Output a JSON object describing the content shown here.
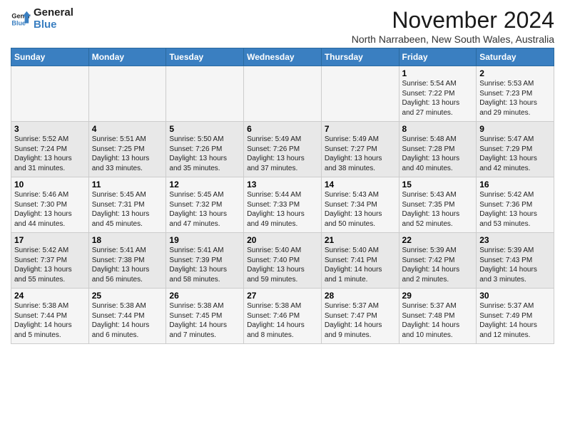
{
  "logo": {
    "line1": "General",
    "line2": "Blue"
  },
  "title": "November 2024",
  "location": "North Narrabeen, New South Wales, Australia",
  "weekdays": [
    "Sunday",
    "Monday",
    "Tuesday",
    "Wednesday",
    "Thursday",
    "Friday",
    "Saturday"
  ],
  "weeks": [
    [
      {
        "day": "",
        "info": ""
      },
      {
        "day": "",
        "info": ""
      },
      {
        "day": "",
        "info": ""
      },
      {
        "day": "",
        "info": ""
      },
      {
        "day": "",
        "info": ""
      },
      {
        "day": "1",
        "info": "Sunrise: 5:54 AM\nSunset: 7:22 PM\nDaylight: 13 hours and 27 minutes."
      },
      {
        "day": "2",
        "info": "Sunrise: 5:53 AM\nSunset: 7:23 PM\nDaylight: 13 hours and 29 minutes."
      }
    ],
    [
      {
        "day": "3",
        "info": "Sunrise: 5:52 AM\nSunset: 7:24 PM\nDaylight: 13 hours and 31 minutes."
      },
      {
        "day": "4",
        "info": "Sunrise: 5:51 AM\nSunset: 7:25 PM\nDaylight: 13 hours and 33 minutes."
      },
      {
        "day": "5",
        "info": "Sunrise: 5:50 AM\nSunset: 7:26 PM\nDaylight: 13 hours and 35 minutes."
      },
      {
        "day": "6",
        "info": "Sunrise: 5:49 AM\nSunset: 7:26 PM\nDaylight: 13 hours and 37 minutes."
      },
      {
        "day": "7",
        "info": "Sunrise: 5:49 AM\nSunset: 7:27 PM\nDaylight: 13 hours and 38 minutes."
      },
      {
        "day": "8",
        "info": "Sunrise: 5:48 AM\nSunset: 7:28 PM\nDaylight: 13 hours and 40 minutes."
      },
      {
        "day": "9",
        "info": "Sunrise: 5:47 AM\nSunset: 7:29 PM\nDaylight: 13 hours and 42 minutes."
      }
    ],
    [
      {
        "day": "10",
        "info": "Sunrise: 5:46 AM\nSunset: 7:30 PM\nDaylight: 13 hours and 44 minutes."
      },
      {
        "day": "11",
        "info": "Sunrise: 5:45 AM\nSunset: 7:31 PM\nDaylight: 13 hours and 45 minutes."
      },
      {
        "day": "12",
        "info": "Sunrise: 5:45 AM\nSunset: 7:32 PM\nDaylight: 13 hours and 47 minutes."
      },
      {
        "day": "13",
        "info": "Sunrise: 5:44 AM\nSunset: 7:33 PM\nDaylight: 13 hours and 49 minutes."
      },
      {
        "day": "14",
        "info": "Sunrise: 5:43 AM\nSunset: 7:34 PM\nDaylight: 13 hours and 50 minutes."
      },
      {
        "day": "15",
        "info": "Sunrise: 5:43 AM\nSunset: 7:35 PM\nDaylight: 13 hours and 52 minutes."
      },
      {
        "day": "16",
        "info": "Sunrise: 5:42 AM\nSunset: 7:36 PM\nDaylight: 13 hours and 53 minutes."
      }
    ],
    [
      {
        "day": "17",
        "info": "Sunrise: 5:42 AM\nSunset: 7:37 PM\nDaylight: 13 hours and 55 minutes."
      },
      {
        "day": "18",
        "info": "Sunrise: 5:41 AM\nSunset: 7:38 PM\nDaylight: 13 hours and 56 minutes."
      },
      {
        "day": "19",
        "info": "Sunrise: 5:41 AM\nSunset: 7:39 PM\nDaylight: 13 hours and 58 minutes."
      },
      {
        "day": "20",
        "info": "Sunrise: 5:40 AM\nSunset: 7:40 PM\nDaylight: 13 hours and 59 minutes."
      },
      {
        "day": "21",
        "info": "Sunrise: 5:40 AM\nSunset: 7:41 PM\nDaylight: 14 hours and 1 minute."
      },
      {
        "day": "22",
        "info": "Sunrise: 5:39 AM\nSunset: 7:42 PM\nDaylight: 14 hours and 2 minutes."
      },
      {
        "day": "23",
        "info": "Sunrise: 5:39 AM\nSunset: 7:43 PM\nDaylight: 14 hours and 3 minutes."
      }
    ],
    [
      {
        "day": "24",
        "info": "Sunrise: 5:38 AM\nSunset: 7:44 PM\nDaylight: 14 hours and 5 minutes."
      },
      {
        "day": "25",
        "info": "Sunrise: 5:38 AM\nSunset: 7:44 PM\nDaylight: 14 hours and 6 minutes."
      },
      {
        "day": "26",
        "info": "Sunrise: 5:38 AM\nSunset: 7:45 PM\nDaylight: 14 hours and 7 minutes."
      },
      {
        "day": "27",
        "info": "Sunrise: 5:38 AM\nSunset: 7:46 PM\nDaylight: 14 hours and 8 minutes."
      },
      {
        "day": "28",
        "info": "Sunrise: 5:37 AM\nSunset: 7:47 PM\nDaylight: 14 hours and 9 minutes."
      },
      {
        "day": "29",
        "info": "Sunrise: 5:37 AM\nSunset: 7:48 PM\nDaylight: 14 hours and 10 minutes."
      },
      {
        "day": "30",
        "info": "Sunrise: 5:37 AM\nSunset: 7:49 PM\nDaylight: 14 hours and 12 minutes."
      }
    ]
  ]
}
